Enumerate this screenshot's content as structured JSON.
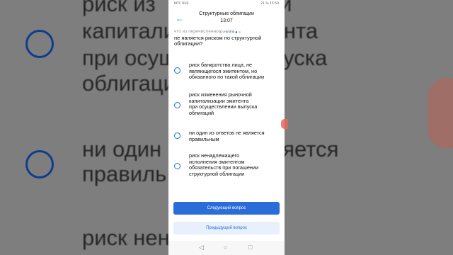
{
  "status_bar": {
    "left": "МТС RUS",
    "right": "21 % 15:50"
  },
  "header": {
    "title": "Структурные облигации",
    "time": "13:07"
  },
  "question": {
    "faded_line": "что из перечисленного ниже,",
    "text": "не является риском по структурной облигации?"
  },
  "options": [
    {
      "text": "риск банкротства лица, не\nявляющегося эмитентом, но\nобязанного по такой облигации"
    },
    {
      "text": "риск изменения рыночной\nкапитализации эмитента\nпри осуществлении выпуска\nоблигаций"
    },
    {
      "text": "ни один из ответов не является\nправильным"
    },
    {
      "text": "риск ненадлежащего\nисполнения эмитентом\nобязательств при погашении\nструктурной облигации"
    }
  ],
  "buttons": {
    "next": "Следующий вопрос",
    "prev": "Предыдущий вопрос"
  },
  "navbar": {
    "back": "◁",
    "home": "○",
    "recent": "□"
  },
  "background": {
    "line1": "риск из        ыночной",
    "line2": "капитализ        митента",
    "line3": "при осущ        и выпуска",
    "line4": "облигаци",
    "line5": "ни один         не является",
    "line6": "правиль",
    "line7": "риск нен        его"
  },
  "colors": {
    "accent": "#2a6cd8",
    "accent_light": "#e7f0fc",
    "background_dim": "#7e7e7e"
  }
}
